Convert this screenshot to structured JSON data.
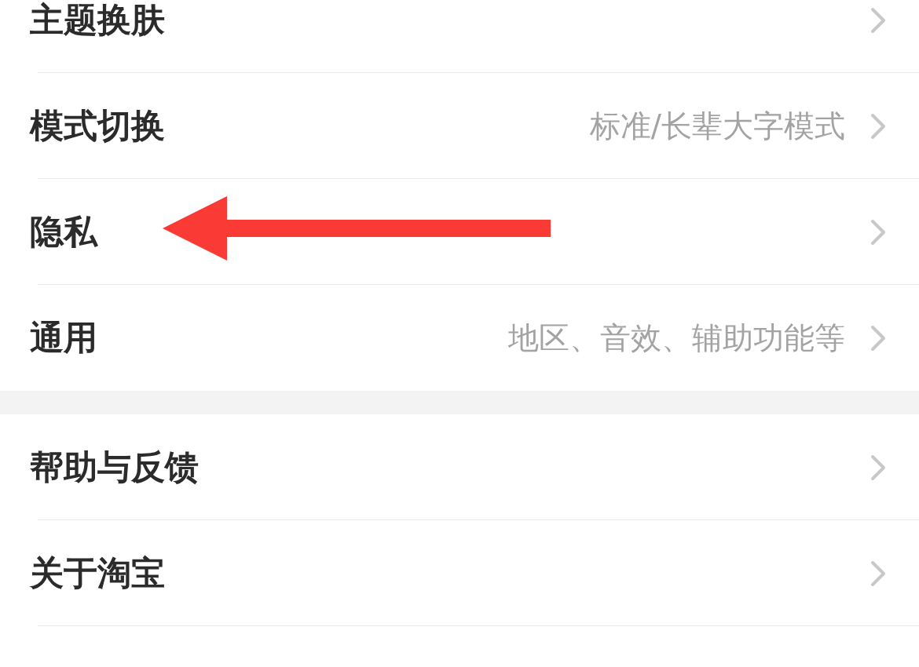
{
  "groups": [
    {
      "rows": [
        {
          "label": "主题换肤"
        },
        {
          "label": "模式切换",
          "value": "标准/长辈大字模式"
        },
        {
          "label": "隐私"
        },
        {
          "label": "通用",
          "value": "地区、音效、辅助功能等"
        }
      ]
    },
    {
      "rows": [
        {
          "label": "帮助与反馈"
        },
        {
          "label": "关于淘宝"
        }
      ]
    }
  ]
}
